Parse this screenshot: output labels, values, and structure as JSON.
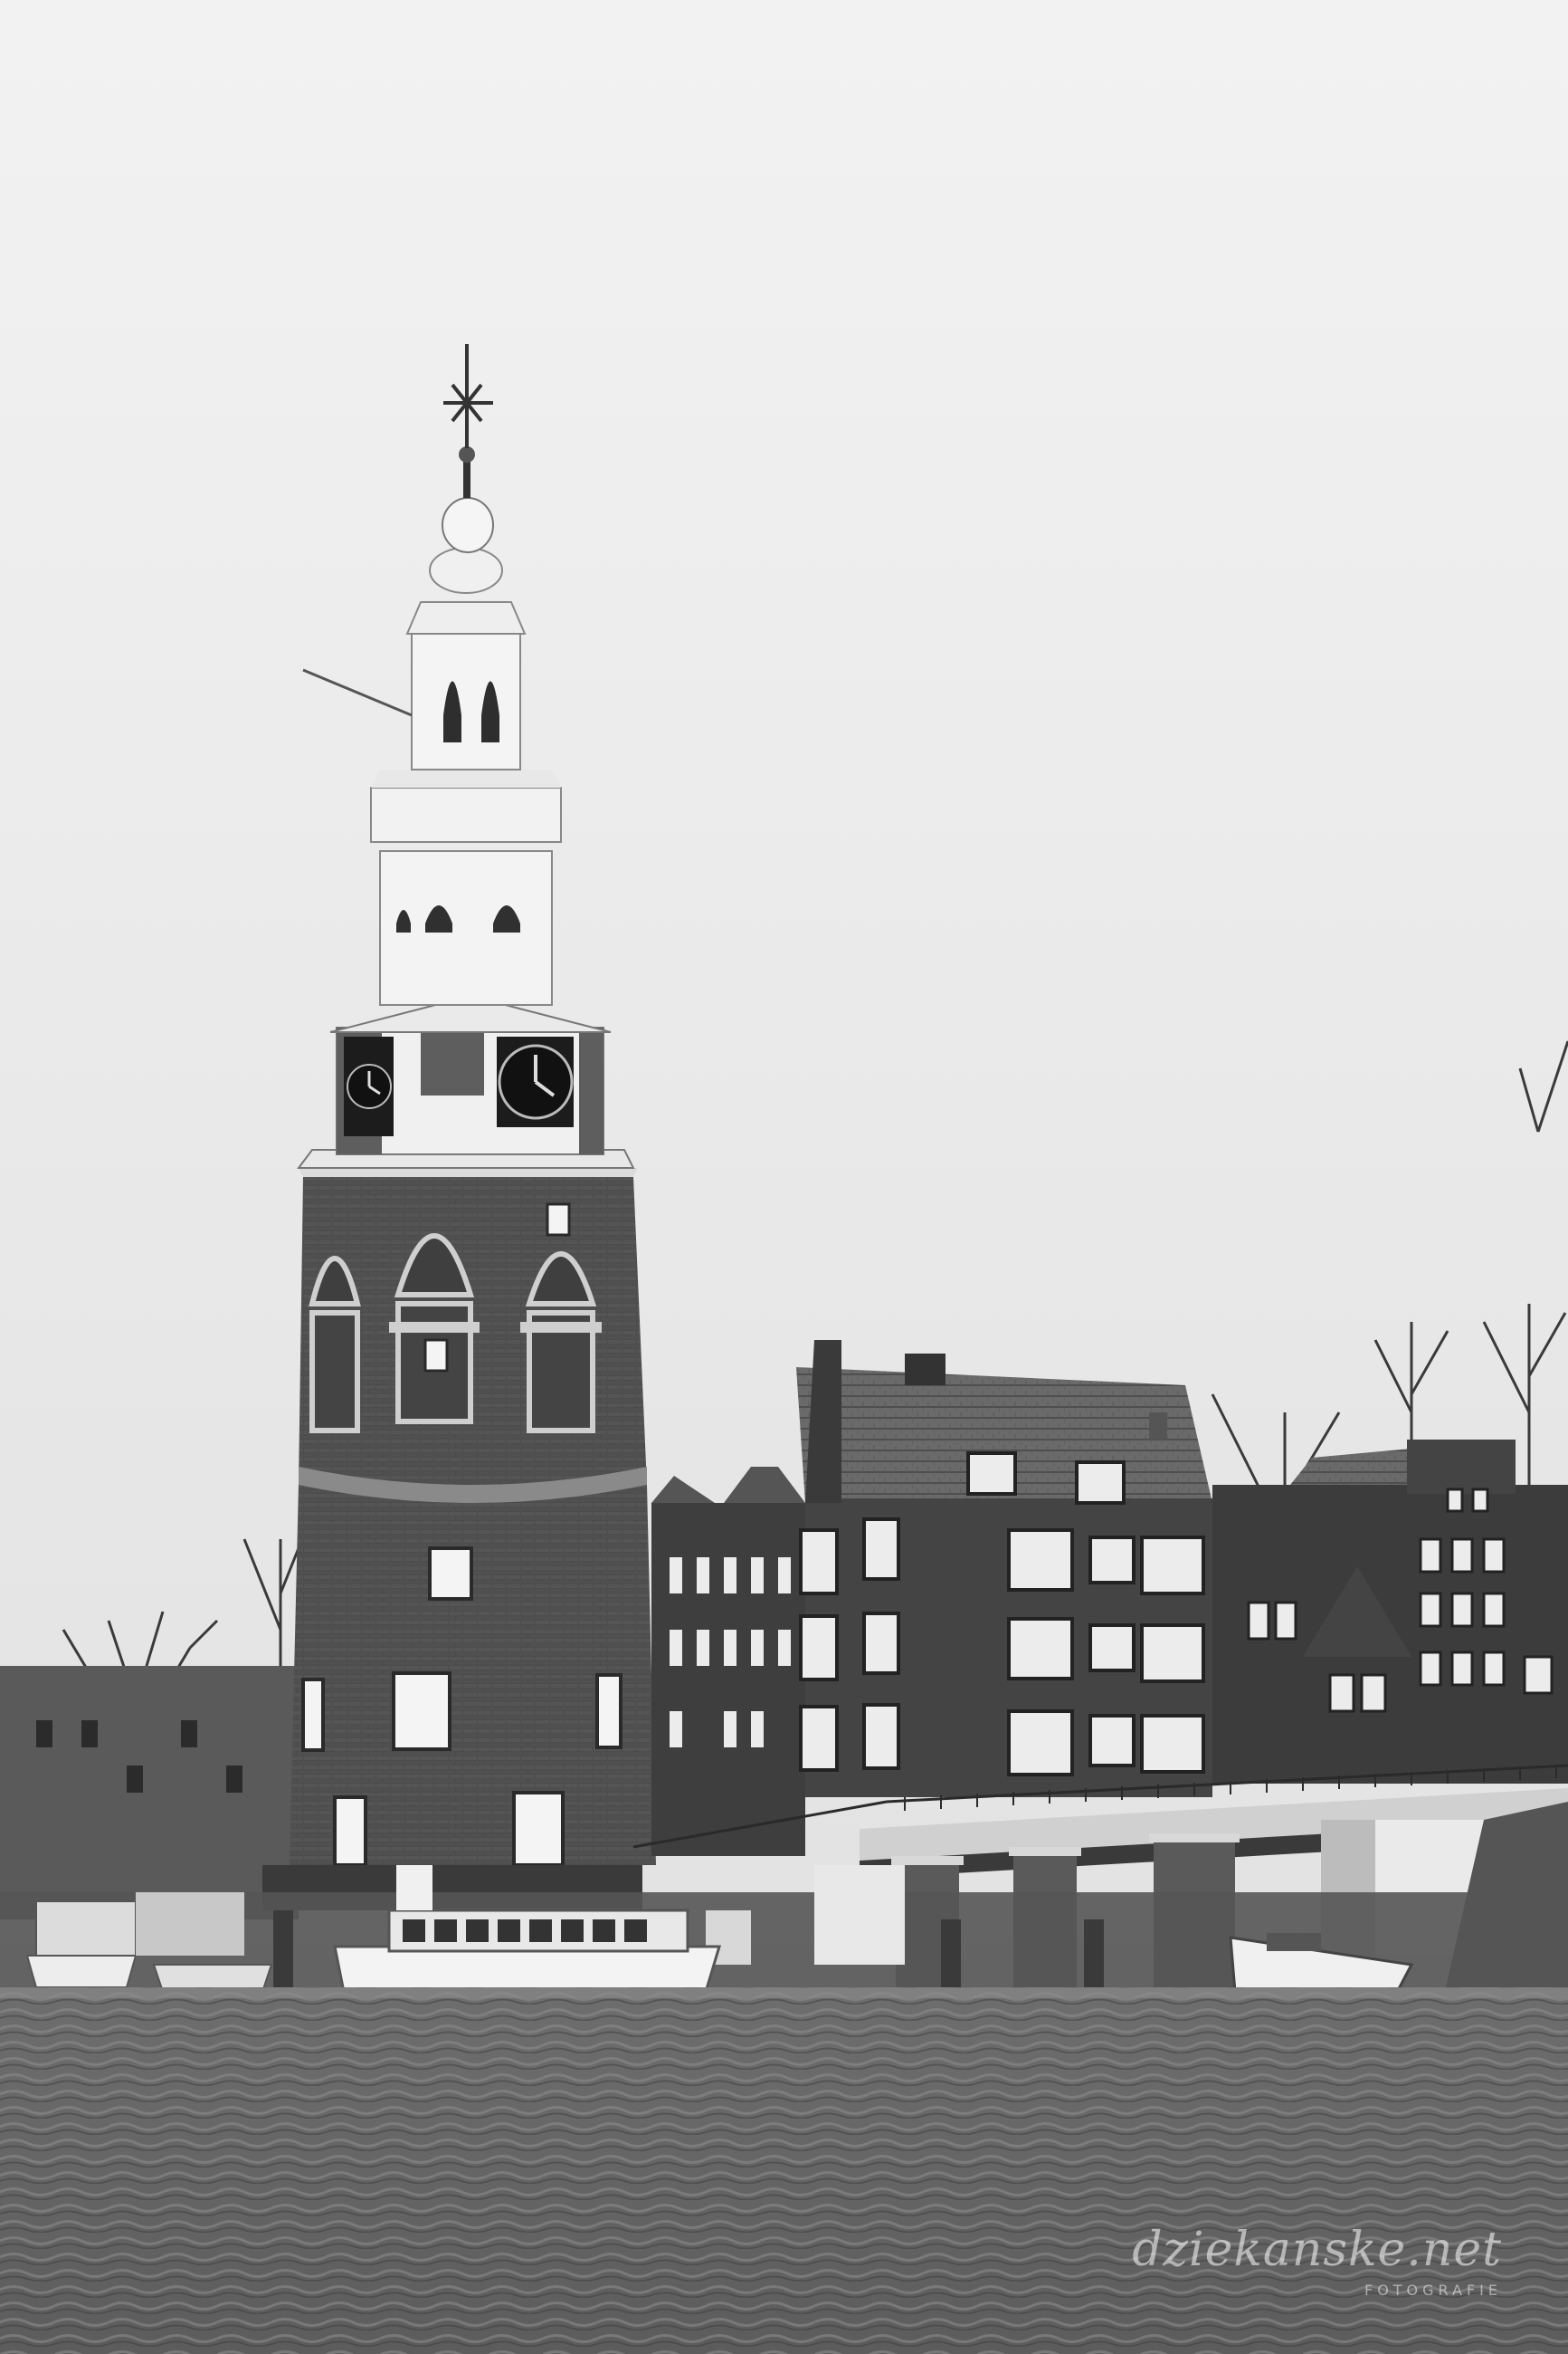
{
  "photo": {
    "style": "black-and-white",
    "subject": "canal-tower-scene"
  },
  "watermark": {
    "text": "dziekanske.net",
    "subtext": "FOTOGRAFIE"
  },
  "icons": [
    "weathervane-icon",
    "clock-icon"
  ]
}
